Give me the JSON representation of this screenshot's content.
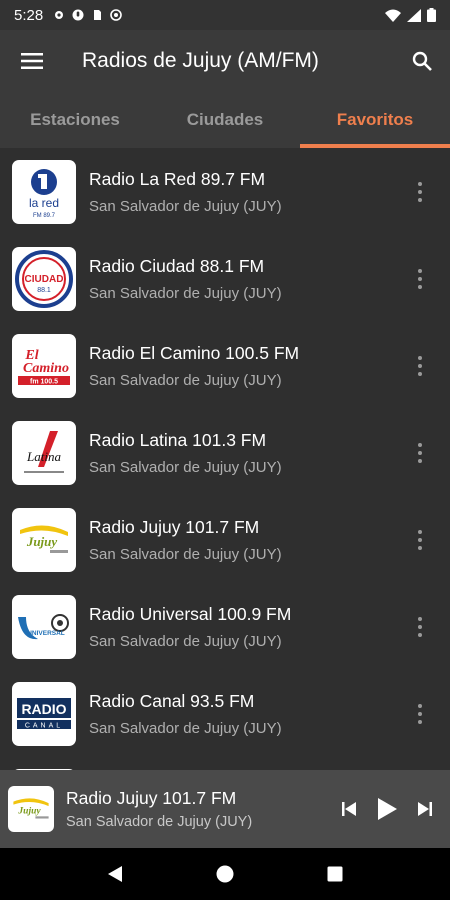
{
  "status": {
    "time": "5:28"
  },
  "app": {
    "title": "Radios de Jujuy (AM/FM)"
  },
  "tabs": [
    {
      "label": "Estaciones",
      "active": false
    },
    {
      "label": "Ciudades",
      "active": false
    },
    {
      "label": "Favoritos",
      "active": true
    }
  ],
  "colors": {
    "accent": "#ef7f4d",
    "background": "#2f2f2f",
    "appbar": "#3a3a3a",
    "player": "#4a4a4a"
  },
  "stations": [
    {
      "name": "Radio La Red 89.7 FM",
      "city": "San Salvador de Jujuy (JUY)",
      "logo": {
        "top": "",
        "bottom": "la red",
        "sub": "FM 89.7"
      }
    },
    {
      "name": "Radio Ciudad 88.1 FM",
      "city": "San Salvador de Jujuy (JUY)",
      "logo": {
        "top": "CIUDAD",
        "sub": "88.1"
      }
    },
    {
      "name": "Radio El Camino 100.5 FM",
      "city": "San Salvador de Jujuy (JUY)",
      "logo": {
        "top": "El",
        "bottom": "Camino",
        "sub": "fm 100.5"
      }
    },
    {
      "name": "Radio Latina 101.3 FM",
      "city": "San Salvador de Jujuy (JUY)",
      "logo": {
        "top": "Latina"
      }
    },
    {
      "name": "Radio Jujuy 101.7 FM",
      "city": "San Salvador de Jujuy (JUY)",
      "logo": {
        "top": "Jujuy"
      }
    },
    {
      "name": "Radio Universal 100.9 FM",
      "city": "San Salvador de Jujuy (JUY)",
      "logo": {
        "top": "UNIVERSAL"
      }
    },
    {
      "name": "Radio Canal 93.5 FM",
      "city": "San Salvador de Jujuy (JUY)",
      "logo": {
        "top": "RADIO",
        "bottom": "CANAL"
      }
    }
  ],
  "player": {
    "title": "Radio Jujuy 101.7 FM",
    "city": "San Salvador de Jujuy (JUY)",
    "logo": "Jujuy"
  },
  "icons": {
    "menu": "menu-icon",
    "search": "search-icon",
    "more": "more-vert-icon",
    "prev": "skip-previous-icon",
    "play": "play-icon",
    "next": "skip-next-icon",
    "back": "back-icon",
    "home": "home-icon",
    "recents": "recents-icon"
  }
}
